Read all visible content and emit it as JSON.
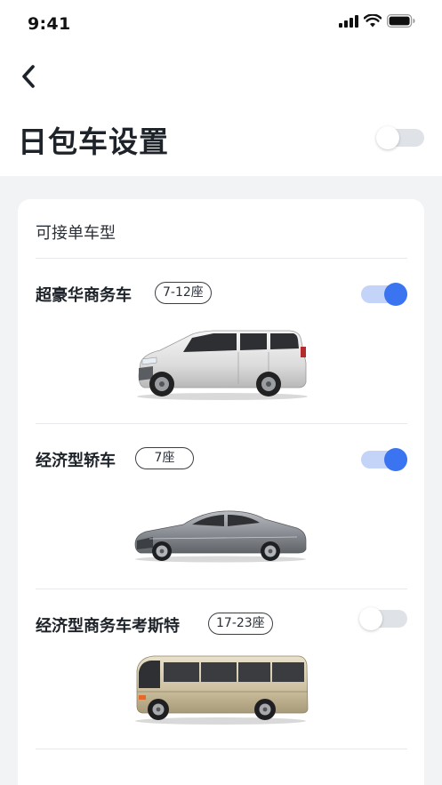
{
  "status_bar": {
    "time": "9:41"
  },
  "header": {
    "title": "日包车设置",
    "master_toggle": "off"
  },
  "card": {
    "section_title": "可接单车型",
    "vehicles": [
      {
        "name": "超豪华商务车",
        "seats": "7-12座",
        "enabled": "on",
        "image": "luxury-minivan"
      },
      {
        "name": "经济型轿车",
        "seats": "7座",
        "enabled": "on",
        "image": "sedan"
      },
      {
        "name": "经济型商务车考斯特",
        "seats": "17-23座",
        "enabled": "off",
        "image": "coaster-bus"
      }
    ]
  },
  "colors": {
    "accent": "#3b74f0",
    "toggle_off_track": "#dfe3e8",
    "background": "#f2f3f5"
  }
}
